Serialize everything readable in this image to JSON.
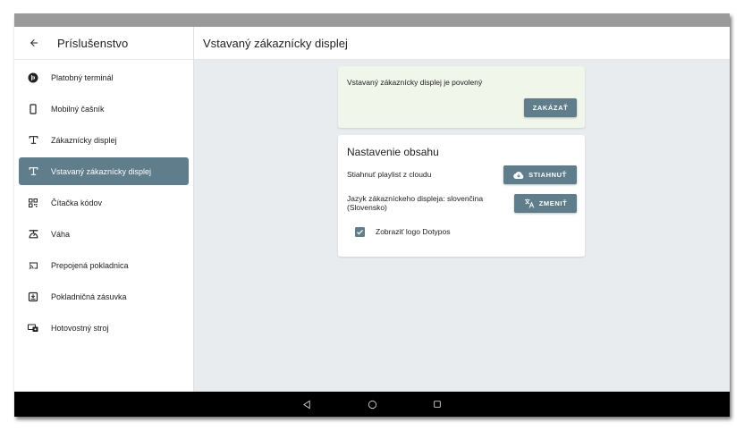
{
  "header": {
    "section_title": "Príslušenstvo",
    "page_title": "Vstavaný zákaznícky displej"
  },
  "sidebar": {
    "items": [
      {
        "label": "Platobný terminál",
        "icon": "payment-terminal-icon",
        "active": false
      },
      {
        "label": "Mobilný čašník",
        "icon": "mobile-phone-icon",
        "active": false
      },
      {
        "label": "Zákaznícky displej",
        "icon": "customer-display-icon",
        "active": false
      },
      {
        "label": "Vstavaný zákaznícky displej",
        "icon": "customer-display-icon",
        "active": true
      },
      {
        "label": "Čítačka kódov",
        "icon": "qr-code-icon",
        "active": false
      },
      {
        "label": "Váha",
        "icon": "scale-icon",
        "active": false
      },
      {
        "label": "Prepojená pokladnica",
        "icon": "cast-icon",
        "active": false
      },
      {
        "label": "Pokladničná zásuvka",
        "icon": "cash-drawer-icon",
        "active": false
      },
      {
        "label": "Hotovostný stroj",
        "icon": "cash-machine-icon",
        "active": false
      }
    ]
  },
  "status_card": {
    "message": "Vstavaný zákaznícky displej je povolený",
    "disable_label": "ZAKÁZAŤ"
  },
  "settings_card": {
    "heading": "Nastavenie obsahu",
    "playlist_label": "Stiahnuť playlist z cloudu",
    "download_label": "STIAHNUŤ",
    "language_label": "Jazyk zákazníckeho displeja: slovenčina (Slovensko)",
    "change_label": "ZMENIŤ",
    "logo_label": "Zobraziť logo Dotypos",
    "logo_checked": true
  },
  "colors": {
    "accent": "#607d8b",
    "status_bg": "#f1f6ea",
    "content_bg": "#e9ecef"
  }
}
